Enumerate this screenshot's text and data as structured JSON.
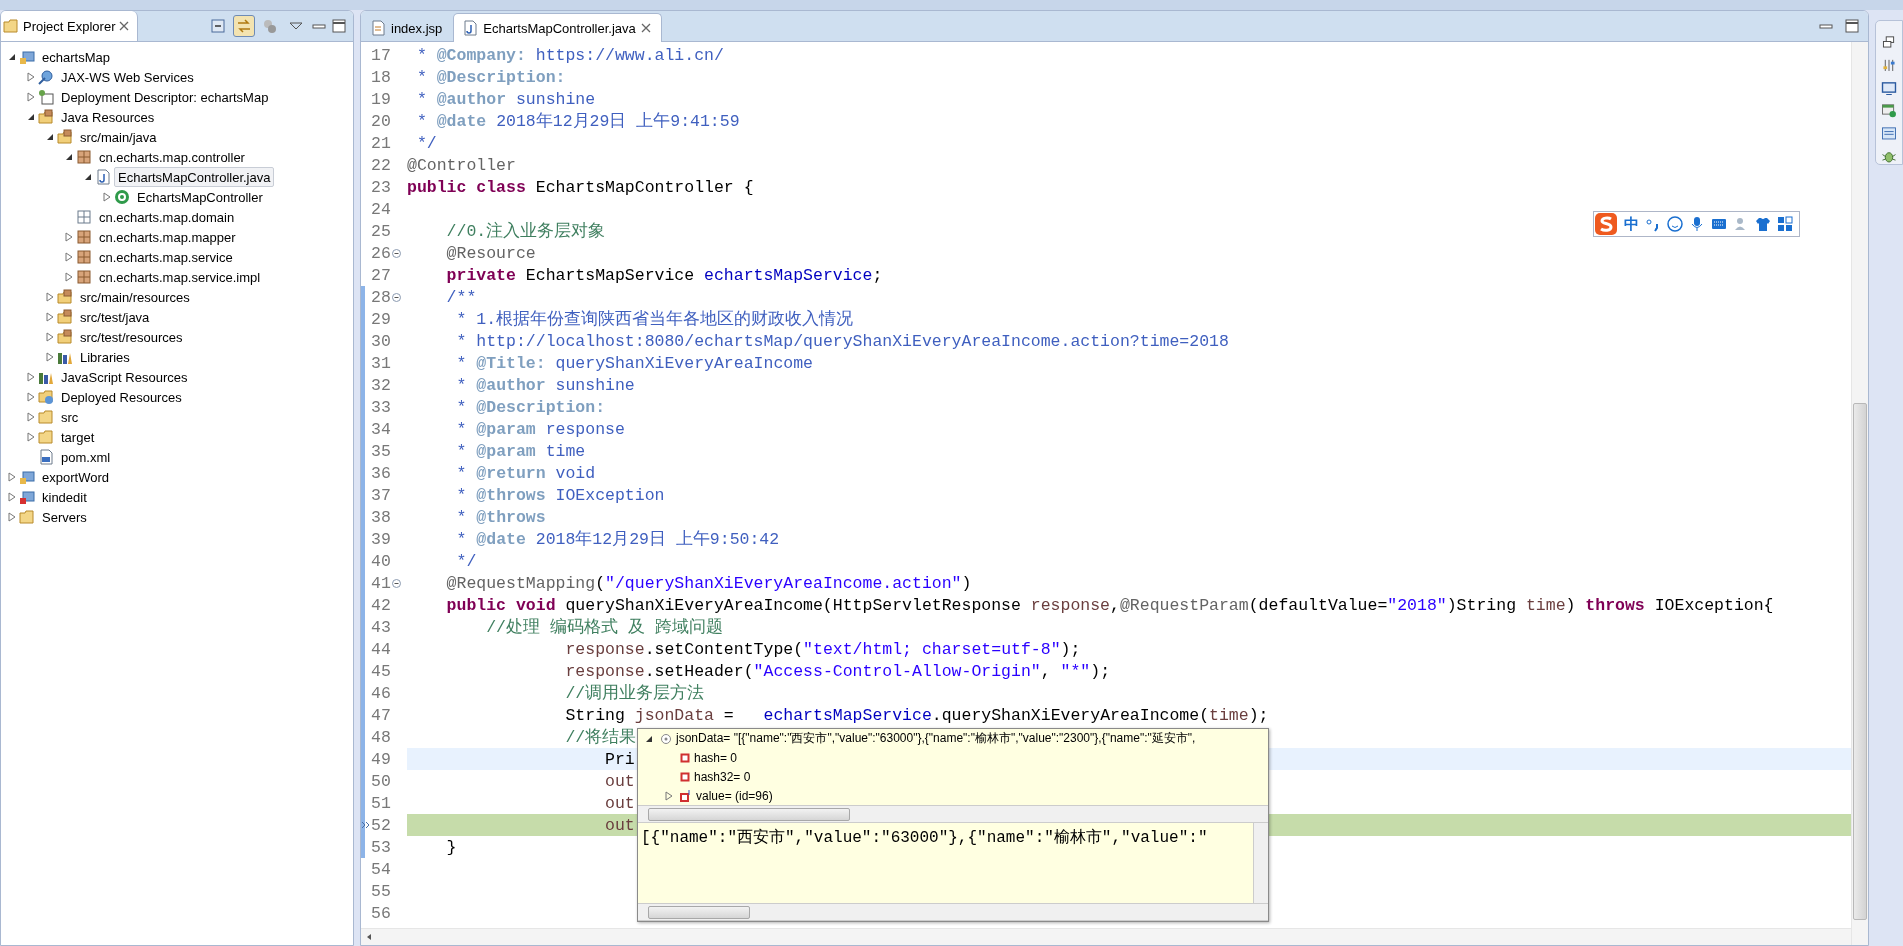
{
  "explorer": {
    "title": "Project Explorer",
    "toolbar": [
      {
        "kind": "collapse",
        "pressed": false
      },
      {
        "kind": "link",
        "pressed": true
      },
      {
        "kind": "filter",
        "pressed": false
      },
      {
        "kind": "menu",
        "pressed": false
      }
    ],
    "items": [
      {
        "label": "echartsMap",
        "kind": "project",
        "expanded": true,
        "selected": false,
        "children": [
          {
            "label": "JAX-WS Web Services",
            "kind": "webservice",
            "expanded": false,
            "selected": false
          },
          {
            "label": "Deployment Descriptor: echartsMap",
            "kind": "descriptor",
            "expanded": false,
            "selected": false
          },
          {
            "label": "Java Resources",
            "kind": "java-resources",
            "expanded": true,
            "selected": false,
            "children": [
              {
                "label": "src/main/java",
                "kind": "source-folder",
                "expanded": true,
                "selected": false,
                "children": [
                  {
                    "label": "cn.echarts.map.controller",
                    "kind": "package",
                    "expanded": true,
                    "selected": false,
                    "children": [
                      {
                        "label": "EchartsMapController.java",
                        "kind": "java-file",
                        "expanded": true,
                        "selected": true,
                        "children": [
                          {
                            "label": "EchartsMapController",
                            "kind": "class",
                            "expanded": false,
                            "selected": false
                          }
                        ]
                      }
                    ]
                  },
                  {
                    "label": "cn.echarts.map.domain",
                    "kind": "empty-package",
                    "selected": false
                  },
                  {
                    "label": "cn.echarts.map.mapper",
                    "kind": "package",
                    "expanded": false,
                    "selected": false
                  },
                  {
                    "label": "cn.echarts.map.service",
                    "kind": "package",
                    "expanded": false,
                    "selected": false
                  },
                  {
                    "label": "cn.echarts.map.service.impl",
                    "kind": "package",
                    "expanded": false,
                    "selected": false
                  }
                ]
              },
              {
                "label": "src/main/resources",
                "kind": "source-folder",
                "expanded": false,
                "selected": false
              },
              {
                "label": "src/test/java",
                "kind": "source-folder",
                "expanded": false,
                "selected": false
              },
              {
                "label": "src/test/resources",
                "kind": "source-folder",
                "expanded": false,
                "selected": false
              },
              {
                "label": "Libraries",
                "kind": "library",
                "expanded": false,
                "selected": false
              }
            ]
          },
          {
            "label": "JavaScript Resources",
            "kind": "library",
            "expanded": false,
            "selected": false
          },
          {
            "label": "Deployed Resources",
            "kind": "deployed",
            "expanded": false,
            "selected": false
          },
          {
            "label": "src",
            "kind": "folder",
            "expanded": false,
            "selected": false
          },
          {
            "label": "target",
            "kind": "folder",
            "expanded": false,
            "selected": false
          },
          {
            "label": "pom.xml",
            "kind": "xml",
            "selected": false
          }
        ]
      },
      {
        "label": "exportWord",
        "kind": "project",
        "expanded": false,
        "selected": false
      },
      {
        "label": "kindedit",
        "kind": "project-error",
        "expanded": false,
        "selected": false
      },
      {
        "label": "Servers",
        "kind": "folder",
        "expanded": false,
        "selected": false
      }
    ]
  },
  "tabs": [
    {
      "label": "index.jsp",
      "kind": "jsp",
      "selected": false
    },
    {
      "label": "EchartsMapController.java",
      "kind": "java",
      "selected": true
    }
  ],
  "code": [
    {
      "number": "17",
      "tokens": [
        {
          "kind": "doc",
          "text": " * "
        },
        {
          "kind": "tag",
          "text": "@Company:"
        },
        {
          "kind": "doc",
          "text": " https://www.ali.cn/"
        }
      ]
    },
    {
      "number": "18",
      "tokens": [
        {
          "kind": "doc",
          "text": " * "
        },
        {
          "kind": "tag",
          "text": "@Description:"
        }
      ]
    },
    {
      "number": "19",
      "tokens": [
        {
          "kind": "doc",
          "text": " * "
        },
        {
          "kind": "tag",
          "text": "@author"
        },
        {
          "kind": "doc",
          "text": " sunshine"
        }
      ]
    },
    {
      "number": "20",
      "tokens": [
        {
          "kind": "doc",
          "text": " * "
        },
        {
          "kind": "tag",
          "text": "@date"
        },
        {
          "kind": "doc",
          "text": " 2018年12月29日 上午9:41:59"
        }
      ]
    },
    {
      "number": "21",
      "tokens": [
        {
          "kind": "doc",
          "text": " */"
        }
      ]
    },
    {
      "number": "22",
      "tokens": [
        {
          "kind": "annotation",
          "text": "@Controller"
        }
      ]
    },
    {
      "number": "23",
      "tokens": [
        {
          "kind": "keyword",
          "text": "public class"
        },
        {
          "kind": "plain",
          "text": " EchartsMapController {"
        }
      ]
    },
    {
      "number": "24"
    },
    {
      "number": "25",
      "tokens": [
        {
          "kind": "comment",
          "text": "    //0.注入业务层对象"
        }
      ]
    },
    {
      "number": "26",
      "fold": true,
      "tokens": [
        {
          "kind": "annotation",
          "text": "    @Resource"
        }
      ]
    },
    {
      "number": "27",
      "tokens": [
        {
          "kind": "keyword",
          "text": "    private"
        },
        {
          "kind": "plain",
          "text": " EchartsMapService "
        },
        {
          "kind": "field",
          "text": "echartsMapService"
        },
        {
          "kind": "plain",
          "text": ";"
        }
      ]
    },
    {
      "number": "28",
      "fold": true,
      "changed": true,
      "tokens": [
        {
          "kind": "doc",
          "text": "    /**"
        }
      ]
    },
    {
      "number": "29",
      "changed": true,
      "tokens": [
        {
          "kind": "doc",
          "text": "     * 1.根据年份查询陕西省当年各地区的财政收入情况"
        }
      ]
    },
    {
      "number": "30",
      "changed": true,
      "tokens": [
        {
          "kind": "doc",
          "text": "     * http://localhost:8080/echartsMap/queryShanXiEveryAreaIncome.action?time=2018"
        }
      ]
    },
    {
      "number": "31",
      "changed": true,
      "tokens": [
        {
          "kind": "doc",
          "text": "     * "
        },
        {
          "kind": "tag",
          "text": "@Title:"
        },
        {
          "kind": "doc",
          "text": " queryShanXiEveryAreaIncome"
        }
      ]
    },
    {
      "number": "32",
      "changed": true,
      "tokens": [
        {
          "kind": "doc",
          "text": "     * "
        },
        {
          "kind": "tag",
          "text": "@author"
        },
        {
          "kind": "doc",
          "text": " sunshine"
        }
      ]
    },
    {
      "number": "33",
      "changed": true,
      "tokens": [
        {
          "kind": "doc",
          "text": "     * "
        },
        {
          "kind": "tag",
          "text": "@Description:"
        }
      ]
    },
    {
      "number": "34",
      "changed": true,
      "tokens": [
        {
          "kind": "doc",
          "text": "     * "
        },
        {
          "kind": "tag",
          "text": "@param"
        },
        {
          "kind": "doc",
          "text": " response"
        }
      ]
    },
    {
      "number": "35",
      "changed": true,
      "tokens": [
        {
          "kind": "doc",
          "text": "     * "
        },
        {
          "kind": "tag",
          "text": "@param"
        },
        {
          "kind": "doc",
          "text": " time"
        }
      ]
    },
    {
      "number": "36",
      "changed": true,
      "tokens": [
        {
          "kind": "doc",
          "text": "     * "
        },
        {
          "kind": "tag",
          "text": "@return"
        },
        {
          "kind": "doc",
          "text": " void"
        }
      ]
    },
    {
      "number": "37",
      "changed": true,
      "tokens": [
        {
          "kind": "doc",
          "text": "     * "
        },
        {
          "kind": "tag",
          "text": "@throws"
        },
        {
          "kind": "doc",
          "text": " IOException"
        }
      ]
    },
    {
      "number": "38",
      "changed": true,
      "tokens": [
        {
          "kind": "doc",
          "text": "     * "
        },
        {
          "kind": "tag",
          "text": "@throws"
        }
      ]
    },
    {
      "number": "39",
      "changed": true,
      "tokens": [
        {
          "kind": "doc",
          "text": "     * "
        },
        {
          "kind": "tag",
          "text": "@date"
        },
        {
          "kind": "doc",
          "text": " 2018年12月29日 上午9:50:42"
        }
      ]
    },
    {
      "number": "40",
      "changed": true,
      "tokens": [
        {
          "kind": "doc",
          "text": "     */"
        }
      ]
    },
    {
      "number": "41",
      "fold": true,
      "changed": true,
      "tokens": [
        {
          "kind": "annotation",
          "text": "    @RequestMapping"
        },
        {
          "kind": "plain",
          "text": "("
        },
        {
          "kind": "string",
          "text": "\"/queryShanXiEveryAreaIncome.action\""
        },
        {
          "kind": "plain",
          "text": ")"
        }
      ]
    },
    {
      "number": "42",
      "changed": true,
      "tokens": [
        {
          "kind": "keyword",
          "text": "    public void"
        },
        {
          "kind": "plain",
          "text": " queryShanXiEveryAreaIncome(HttpServletResponse "
        },
        {
          "kind": "local",
          "text": "response"
        },
        {
          "kind": "plain",
          "text": ","
        },
        {
          "kind": "annotation",
          "text": "@RequestParam"
        },
        {
          "kind": "plain",
          "text": "(defaultValue="
        },
        {
          "kind": "string",
          "text": "\"2018\""
        },
        {
          "kind": "plain",
          "text": ")String "
        },
        {
          "kind": "local",
          "text": "time"
        },
        {
          "kind": "plain",
          "text": ") "
        },
        {
          "kind": "keyword",
          "text": "throws"
        },
        {
          "kind": "plain",
          "text": " IOException{"
        }
      ]
    },
    {
      "number": "43",
      "changed": true,
      "tokens": [
        {
          "kind": "comment",
          "text": "        //处理 编码格式 及 跨域问题"
        }
      ]
    },
    {
      "number": "44",
      "changed": true,
      "tokens": [
        {
          "kind": "local",
          "text": "                response"
        },
        {
          "kind": "plain",
          "text": ".setContentType("
        },
        {
          "kind": "string",
          "text": "\"text/html; charset=utf-8\""
        },
        {
          "kind": "plain",
          "text": ");"
        }
      ]
    },
    {
      "number": "45",
      "changed": true,
      "tokens": [
        {
          "kind": "local",
          "text": "                response"
        },
        {
          "kind": "plain",
          "text": ".setHeader("
        },
        {
          "kind": "string",
          "text": "\"Access-Control-Allow-Origin\""
        },
        {
          "kind": "plain",
          "text": ", "
        },
        {
          "kind": "string",
          "text": "\"*\""
        },
        {
          "kind": "plain",
          "text": ");"
        }
      ]
    },
    {
      "number": "46",
      "changed": true,
      "tokens": [
        {
          "kind": "comment",
          "text": "                //调用业务层方法"
        }
      ]
    },
    {
      "number": "47",
      "changed": true,
      "tokens": [
        {
          "kind": "plain",
          "text": "                String "
        },
        {
          "kind": "local",
          "text": "jsonData"
        },
        {
          "kind": "plain",
          "text": " =   "
        },
        {
          "kind": "field",
          "text": "echartsMapService"
        },
        {
          "kind": "plain",
          "text": ".queryShanXiEveryAreaIncome("
        },
        {
          "kind": "local",
          "text": "time"
        },
        {
          "kind": "plain",
          "text": ");"
        }
      ]
    },
    {
      "number": "48",
      "changed": true,
      "tokens": [
        {
          "kind": "comment",
          "text": "                //将结果"
        }
      ]
    },
    {
      "number": "49",
      "changed": true,
      "current": true,
      "tokens": [
        {
          "kind": "plain",
          "text": "                    Pri"
        }
      ]
    },
    {
      "number": "50",
      "changed": true,
      "tokens": [
        {
          "kind": "local",
          "text": "                    out"
        }
      ]
    },
    {
      "number": "51",
      "changed": true,
      "tokens": [
        {
          "kind": "local",
          "text": "                    out"
        }
      ]
    },
    {
      "number": "52",
      "changed": true,
      "suspended": true,
      "tokens": [
        {
          "kind": "local",
          "text": "                    out"
        }
      ]
    },
    {
      "number": "53",
      "changed": true,
      "tokens": [
        {
          "kind": "plain",
          "text": "    }"
        }
      ]
    },
    {
      "number": "54"
    },
    {
      "number": "55"
    },
    {
      "number": "56"
    }
  ],
  "inspector": {
    "variables": [
      {
        "label": "jsonData= \"[{\"name\":\"西安市\",\"value\":\"63000\"},{\"name\":\"榆林市\",\"value\":\"2300\"},{\"name\":\"延安市\",",
        "kind": "object",
        "expanded": true,
        "children": [
          {
            "label": "hash= 0",
            "kind": "field"
          },
          {
            "label": "hash32= 0",
            "kind": "field"
          },
          {
            "label": "value= (id=96)",
            "kind": "array",
            "expanded": false
          }
        ]
      }
    ],
    "detail": "[{\"name\":\"西安市\",\"value\":\"63000\"},{\"name\":\"榆林市\",\"value\":\""
  },
  "ime_bar": {
    "mode": "中"
  }
}
